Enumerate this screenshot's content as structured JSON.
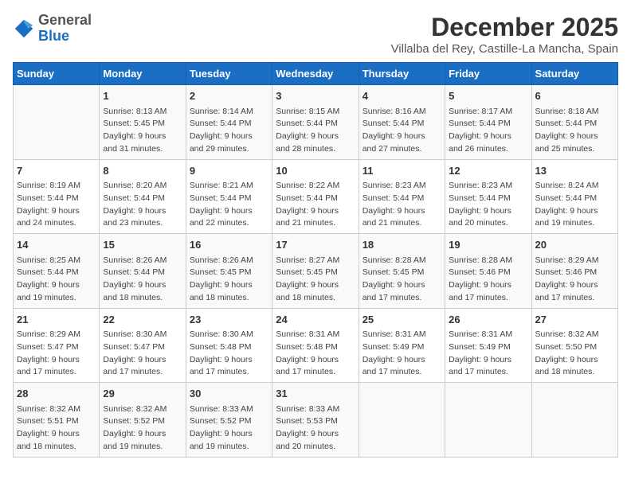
{
  "header": {
    "logo_general": "General",
    "logo_blue": "Blue",
    "month": "December 2025",
    "location": "Villalba del Rey, Castille-La Mancha, Spain"
  },
  "days_of_week": [
    "Sunday",
    "Monday",
    "Tuesday",
    "Wednesday",
    "Thursday",
    "Friday",
    "Saturday"
  ],
  "weeks": [
    [
      {
        "day": "",
        "content": ""
      },
      {
        "day": "1",
        "content": "Sunrise: 8:13 AM\nSunset: 5:45 PM\nDaylight: 9 hours\nand 31 minutes."
      },
      {
        "day": "2",
        "content": "Sunrise: 8:14 AM\nSunset: 5:44 PM\nDaylight: 9 hours\nand 29 minutes."
      },
      {
        "day": "3",
        "content": "Sunrise: 8:15 AM\nSunset: 5:44 PM\nDaylight: 9 hours\nand 28 minutes."
      },
      {
        "day": "4",
        "content": "Sunrise: 8:16 AM\nSunset: 5:44 PM\nDaylight: 9 hours\nand 27 minutes."
      },
      {
        "day": "5",
        "content": "Sunrise: 8:17 AM\nSunset: 5:44 PM\nDaylight: 9 hours\nand 26 minutes."
      },
      {
        "day": "6",
        "content": "Sunrise: 8:18 AM\nSunset: 5:44 PM\nDaylight: 9 hours\nand 25 minutes."
      }
    ],
    [
      {
        "day": "7",
        "content": "Sunrise: 8:19 AM\nSunset: 5:44 PM\nDaylight: 9 hours\nand 24 minutes."
      },
      {
        "day": "8",
        "content": "Sunrise: 8:20 AM\nSunset: 5:44 PM\nDaylight: 9 hours\nand 23 minutes."
      },
      {
        "day": "9",
        "content": "Sunrise: 8:21 AM\nSunset: 5:44 PM\nDaylight: 9 hours\nand 22 minutes."
      },
      {
        "day": "10",
        "content": "Sunrise: 8:22 AM\nSunset: 5:44 PM\nDaylight: 9 hours\nand 21 minutes."
      },
      {
        "day": "11",
        "content": "Sunrise: 8:23 AM\nSunset: 5:44 PM\nDaylight: 9 hours\nand 21 minutes."
      },
      {
        "day": "12",
        "content": "Sunrise: 8:23 AM\nSunset: 5:44 PM\nDaylight: 9 hours\nand 20 minutes."
      },
      {
        "day": "13",
        "content": "Sunrise: 8:24 AM\nSunset: 5:44 PM\nDaylight: 9 hours\nand 19 minutes."
      }
    ],
    [
      {
        "day": "14",
        "content": "Sunrise: 8:25 AM\nSunset: 5:44 PM\nDaylight: 9 hours\nand 19 minutes."
      },
      {
        "day": "15",
        "content": "Sunrise: 8:26 AM\nSunset: 5:44 PM\nDaylight: 9 hours\nand 18 minutes."
      },
      {
        "day": "16",
        "content": "Sunrise: 8:26 AM\nSunset: 5:45 PM\nDaylight: 9 hours\nand 18 minutes."
      },
      {
        "day": "17",
        "content": "Sunrise: 8:27 AM\nSunset: 5:45 PM\nDaylight: 9 hours\nand 18 minutes."
      },
      {
        "day": "18",
        "content": "Sunrise: 8:28 AM\nSunset: 5:45 PM\nDaylight: 9 hours\nand 17 minutes."
      },
      {
        "day": "19",
        "content": "Sunrise: 8:28 AM\nSunset: 5:46 PM\nDaylight: 9 hours\nand 17 minutes."
      },
      {
        "day": "20",
        "content": "Sunrise: 8:29 AM\nSunset: 5:46 PM\nDaylight: 9 hours\nand 17 minutes."
      }
    ],
    [
      {
        "day": "21",
        "content": "Sunrise: 8:29 AM\nSunset: 5:47 PM\nDaylight: 9 hours\nand 17 minutes."
      },
      {
        "day": "22",
        "content": "Sunrise: 8:30 AM\nSunset: 5:47 PM\nDaylight: 9 hours\nand 17 minutes."
      },
      {
        "day": "23",
        "content": "Sunrise: 8:30 AM\nSunset: 5:48 PM\nDaylight: 9 hours\nand 17 minutes."
      },
      {
        "day": "24",
        "content": "Sunrise: 8:31 AM\nSunset: 5:48 PM\nDaylight: 9 hours\nand 17 minutes."
      },
      {
        "day": "25",
        "content": "Sunrise: 8:31 AM\nSunset: 5:49 PM\nDaylight: 9 hours\nand 17 minutes."
      },
      {
        "day": "26",
        "content": "Sunrise: 8:31 AM\nSunset: 5:49 PM\nDaylight: 9 hours\nand 17 minutes."
      },
      {
        "day": "27",
        "content": "Sunrise: 8:32 AM\nSunset: 5:50 PM\nDaylight: 9 hours\nand 18 minutes."
      }
    ],
    [
      {
        "day": "28",
        "content": "Sunrise: 8:32 AM\nSunset: 5:51 PM\nDaylight: 9 hours\nand 18 minutes."
      },
      {
        "day": "29",
        "content": "Sunrise: 8:32 AM\nSunset: 5:52 PM\nDaylight: 9 hours\nand 19 minutes."
      },
      {
        "day": "30",
        "content": "Sunrise: 8:33 AM\nSunset: 5:52 PM\nDaylight: 9 hours\nand 19 minutes."
      },
      {
        "day": "31",
        "content": "Sunrise: 8:33 AM\nSunset: 5:53 PM\nDaylight: 9 hours\nand 20 minutes."
      },
      {
        "day": "",
        "content": ""
      },
      {
        "day": "",
        "content": ""
      },
      {
        "day": "",
        "content": ""
      }
    ]
  ]
}
